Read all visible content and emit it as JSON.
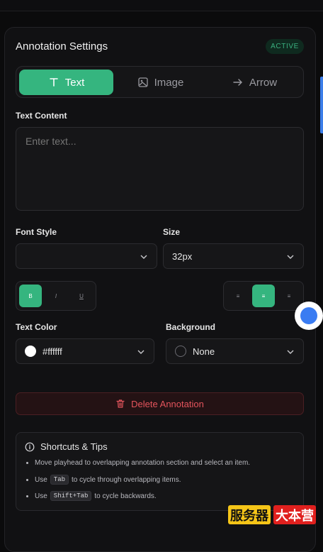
{
  "header": {
    "title": "Annotation Settings",
    "badge": "ACTIVE"
  },
  "tabs": [
    {
      "label": "Text",
      "icon": "text-t-icon",
      "active": true
    },
    {
      "label": "Image",
      "icon": "image-icon",
      "active": false
    },
    {
      "label": "Arrow",
      "icon": "arrow-right-icon",
      "active": false
    }
  ],
  "text_content": {
    "label": "Text Content",
    "value": "Enter text..."
  },
  "font_style": {
    "label": "Font Style",
    "value": ""
  },
  "size": {
    "label": "Size",
    "value": "32px"
  },
  "format_buttons": [
    {
      "label": "B",
      "icon": "bold-icon",
      "active": true
    },
    {
      "label": "I",
      "icon": "italic-icon",
      "active": false
    },
    {
      "label": "U",
      "icon": "underline-icon",
      "active": false
    }
  ],
  "align_buttons": [
    {
      "label": "≡",
      "icon": "align-left-icon",
      "active": false
    },
    {
      "label": "≡",
      "icon": "align-center-icon",
      "active": true
    },
    {
      "label": "≡",
      "icon": "align-right-icon",
      "active": false
    }
  ],
  "text_color": {
    "label": "Text Color",
    "value": "#ffffff",
    "swatch": "#ffffff"
  },
  "background": {
    "label": "Background",
    "value": "None"
  },
  "delete": {
    "label": "Delete Annotation"
  },
  "tips": {
    "title": "Shortcuts & Tips",
    "items": [
      {
        "text": "Move playhead to overlapping annotation section and select an item."
      },
      {
        "pre": "Use",
        "key": "Tab",
        "post": "to cycle through overlapping items."
      },
      {
        "pre": "Use",
        "key": "Shift+Tab",
        "post": "to cycle backwards."
      }
    ]
  },
  "watermark": {
    "left": "服务器",
    "right": "大本营"
  },
  "colors": {
    "accent": "#35b57f",
    "danger": "#e4545c",
    "panel": "#111113"
  }
}
